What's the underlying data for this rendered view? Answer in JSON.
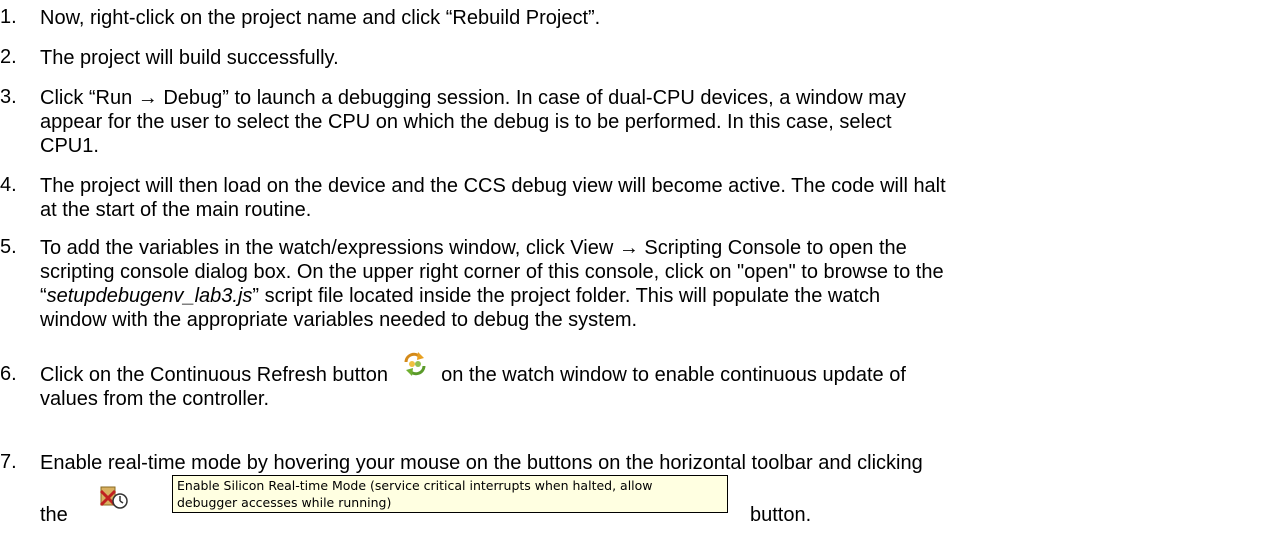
{
  "steps": [
    {
      "number": "1.",
      "lines": [
        "Now, right-click on the project name and click “Rebuild Project”."
      ]
    },
    {
      "number": "2.",
      "lines": [
        "The project will build successfully."
      ]
    },
    {
      "number": "3.",
      "lines": [
        "Click “Run → Debug” to launch a debugging session. In case of dual-CPU devices, a window may",
        "appear for the user to select the CPU on which the debug is to be performed. In this case, select",
        "CPU1."
      ]
    },
    {
      "number": "4.",
      "lines": [
        "The project will then load on the device and the CCS debug view will become active. The code will halt",
        "at the start of the main routine."
      ]
    },
    {
      "number": "5.",
      "lines": [
        "To add the variables in the watch/expressions window, click View → Scripting Console to open the",
        "scripting console dialog box. On the upper right corner of this console, click on \"open\" to browse to the",
        "“",
        "setupdebugenv_lab3.js",
        "” script file located inside the project folder. This will populate the watch",
        "window with the appropriate variables needed to debug the system."
      ]
    },
    {
      "number": "6.",
      "lines": [
        "Click on the Continuous Refresh button",
        "on the watch window to enable continuous update of",
        "values from the controller."
      ]
    },
    {
      "number": "7.",
      "lines": [
        "Enable real-time mode by hovering your mouse on the buttons on the horizontal toolbar and clicking",
        "the",
        "button."
      ]
    }
  ],
  "icons": {
    "continuous_refresh": "continuous-refresh-icon",
    "realtime_mode": "silicon-realtime-mode-icon"
  },
  "tooltip": {
    "line1": "Enable Silicon Real-time Mode (service critical interrupts when halted, allow",
    "line2": "debugger accesses while running)"
  }
}
